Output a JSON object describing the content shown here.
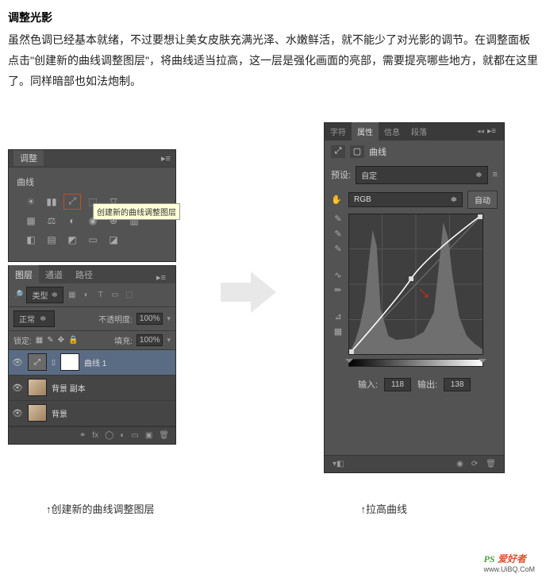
{
  "article": {
    "title": "调整光影",
    "body": "虽然色调已经基本就绪，不过要想让美女皮肤充满光泽、水嫩鲜活，就不能少了对光影的调节。在调整面板点击\"创建新的曲线调整图层\"，将曲线适当拉高，这一层是强化画面的亮部，需要提亮哪些地方，就都在这里了。同样暗部也如法炮制。"
  },
  "adjustments": {
    "panel_title": "调整",
    "section": "曲线",
    "tooltip": "创建新的曲线调整图层"
  },
  "layers": {
    "tabs": [
      "图层",
      "通道",
      "路径"
    ],
    "filter": "类型",
    "blend_mode": "正常",
    "opacity_label": "不透明度:",
    "opacity_value": "100%",
    "lock_label": "锁定:",
    "fill_label": "填充:",
    "fill_value": "100%",
    "items": [
      {
        "name": "曲线 1",
        "type": "curves",
        "selected": true
      },
      {
        "name": "背景 副本",
        "type": "image",
        "selected": false
      },
      {
        "name": "背景",
        "type": "image",
        "selected": false
      }
    ]
  },
  "properties": {
    "tabs": [
      "字符",
      "属性",
      "信息",
      "段落"
    ],
    "title": "曲线",
    "preset_label": "预设:",
    "preset_value": "自定",
    "channel": "RGB",
    "auto": "自动",
    "input_label": "输入:",
    "input_value": "118",
    "output_label": "输出:",
    "output_value": "138"
  },
  "captions": {
    "left": "↑创建新的曲线调整图层",
    "right": "↑拉高曲线"
  },
  "watermark": {
    "brand1": "PS",
    "brand2": "爱好者",
    "url": "www.UiBQ.CoM"
  },
  "chart_data": {
    "type": "line",
    "title": "Curves Adjustment",
    "xlabel": "Input",
    "ylabel": "Output",
    "xlim": [
      0,
      255
    ],
    "ylim": [
      0,
      255
    ],
    "series": [
      {
        "name": "curve",
        "values": [
          [
            0,
            0
          ],
          [
            118,
            138
          ],
          [
            255,
            255
          ]
        ]
      }
    ],
    "histogram_peaks": [
      30,
      180
    ],
    "selected_point": {
      "x": 118,
      "y": 138
    }
  }
}
